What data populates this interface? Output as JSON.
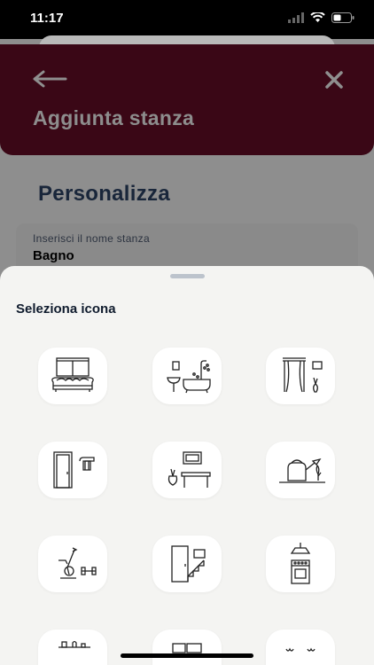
{
  "status": {
    "time": "11:17"
  },
  "header": {
    "title": "Aggiunta stanza"
  },
  "main": {
    "section_title": "Personalizza",
    "name_field": {
      "label": "Inserisci il nome stanza",
      "value": "Bagno"
    }
  },
  "sheet": {
    "title": "Seleziona icona",
    "icons": [
      "living-room-sofa-icon",
      "bathroom-icon",
      "bedroom-window-icon",
      "entrance-door-icon",
      "dining-room-icon",
      "garden-plants-icon",
      "gym-exercise-icon",
      "stairs-room-icon",
      "kitchen-stove-icon",
      "shelf-room-icon",
      "tv-room-icon",
      "terrace-icon"
    ]
  },
  "colors": {
    "header": "#3a0716",
    "sheet": "#f4f4f2",
    "title_text": "#19263a"
  }
}
